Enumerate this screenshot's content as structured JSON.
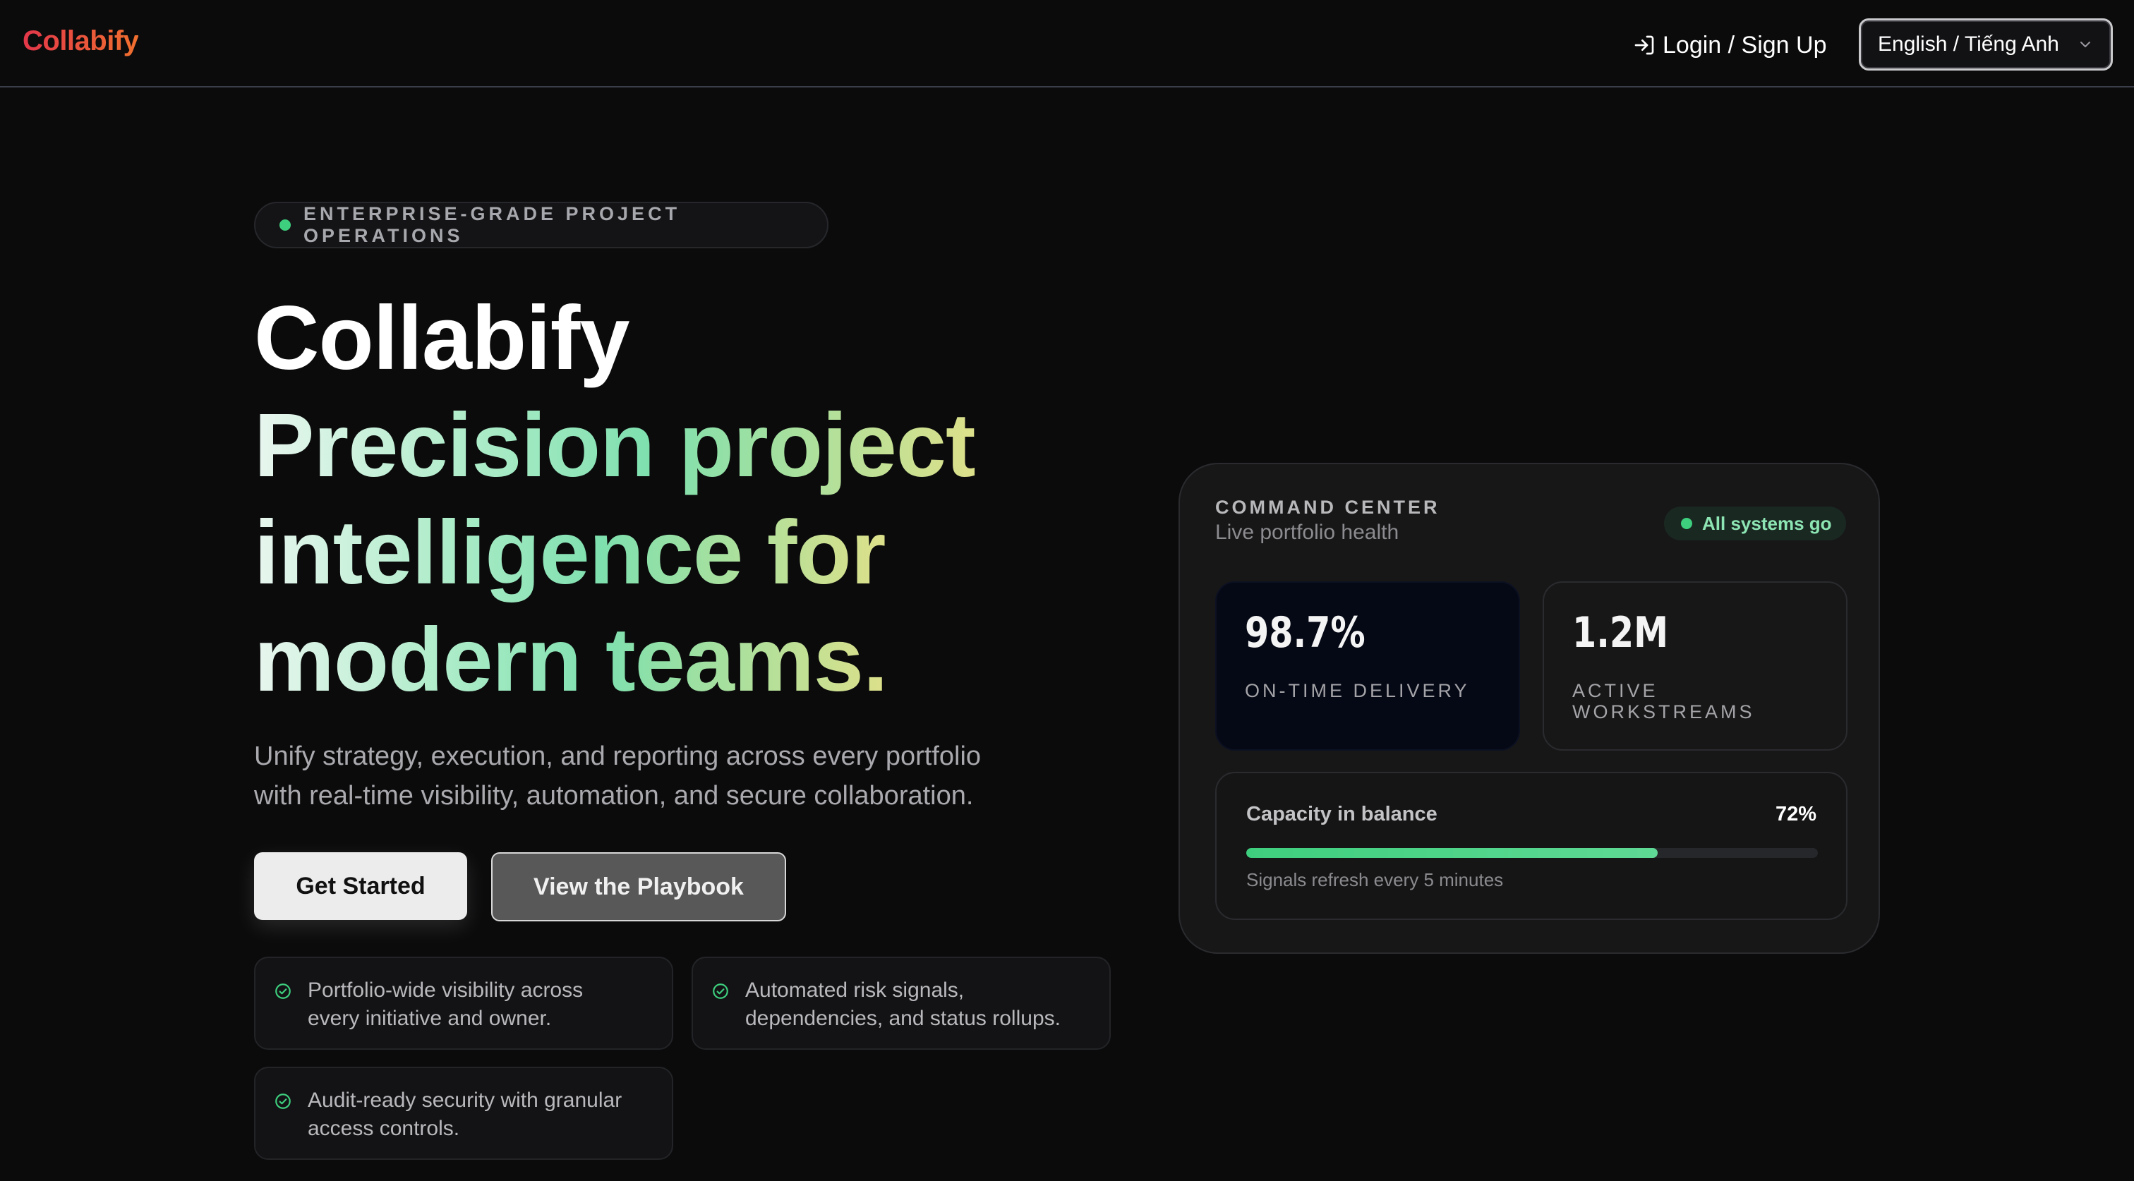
{
  "header": {
    "brand": "Collabify",
    "login_label": "Login / Sign Up",
    "language_selected": "English / Tiếng Anh"
  },
  "hero": {
    "eyebrow": "ENTERPRISE-GRADE PROJECT OPERATIONS",
    "title_line1": "Collabify",
    "title_line2": "Precision project",
    "title_line3": "intelligence for",
    "title_line4": "modern teams.",
    "subtitle_line1": "Unify strategy, execution, and reporting across every portfolio",
    "subtitle_line2": "with real-time visibility, automation, and secure collaboration.",
    "primary_cta": "Get Started",
    "secondary_cta": "View the Playbook"
  },
  "features": [
    {
      "line1": "Portfolio-wide visibility across",
      "line2": "every initiative and owner."
    },
    {
      "line1": "Automated risk signals,",
      "line2": "dependencies, and status rollups."
    },
    {
      "line1": "Audit-ready security with granular",
      "line2": "access controls."
    }
  ],
  "command_center": {
    "title": "COMMAND CENTER",
    "subtitle": "Live portfolio health",
    "status": "All systems go",
    "metrics": [
      {
        "value": "98.7%",
        "label_line1": "ON-TIME DELIVERY",
        "label_line2": ""
      },
      {
        "value": "1.2M",
        "label_line1": "ACTIVE",
        "label_line2": "WORKSTREAMS"
      }
    ],
    "capacity": {
      "label": "Capacity in balance",
      "percent_text": "72%",
      "value": 0.72,
      "note": "Signals refresh every 5 minutes"
    }
  },
  "colors": {
    "accent_green": "#3ecf7e",
    "brand_start": "#e3374a",
    "brand_end": "#f0702e",
    "metric_highlight_bg": "#050815"
  }
}
